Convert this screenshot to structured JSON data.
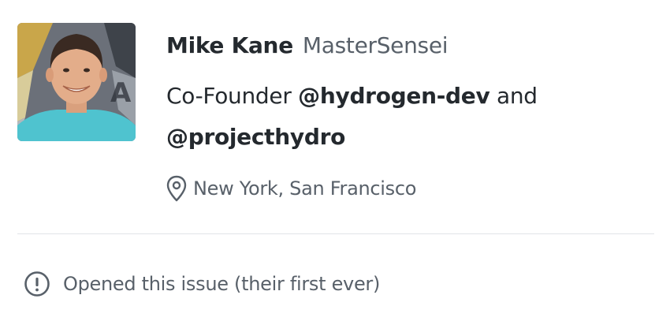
{
  "user": {
    "name": "Mike Kane",
    "login": "MasterSensei",
    "bio_prefix": "Co-Founder ",
    "bio_mention_1": "@hydrogen-dev",
    "bio_mid": " and ",
    "bio_mention_2": "@projecthydro",
    "location": "New York, San Francisco",
    "location_icon": "location-pin-icon"
  },
  "footer": {
    "text": "Opened this issue (their first ever)",
    "icon": "issue-opened-icon"
  }
}
